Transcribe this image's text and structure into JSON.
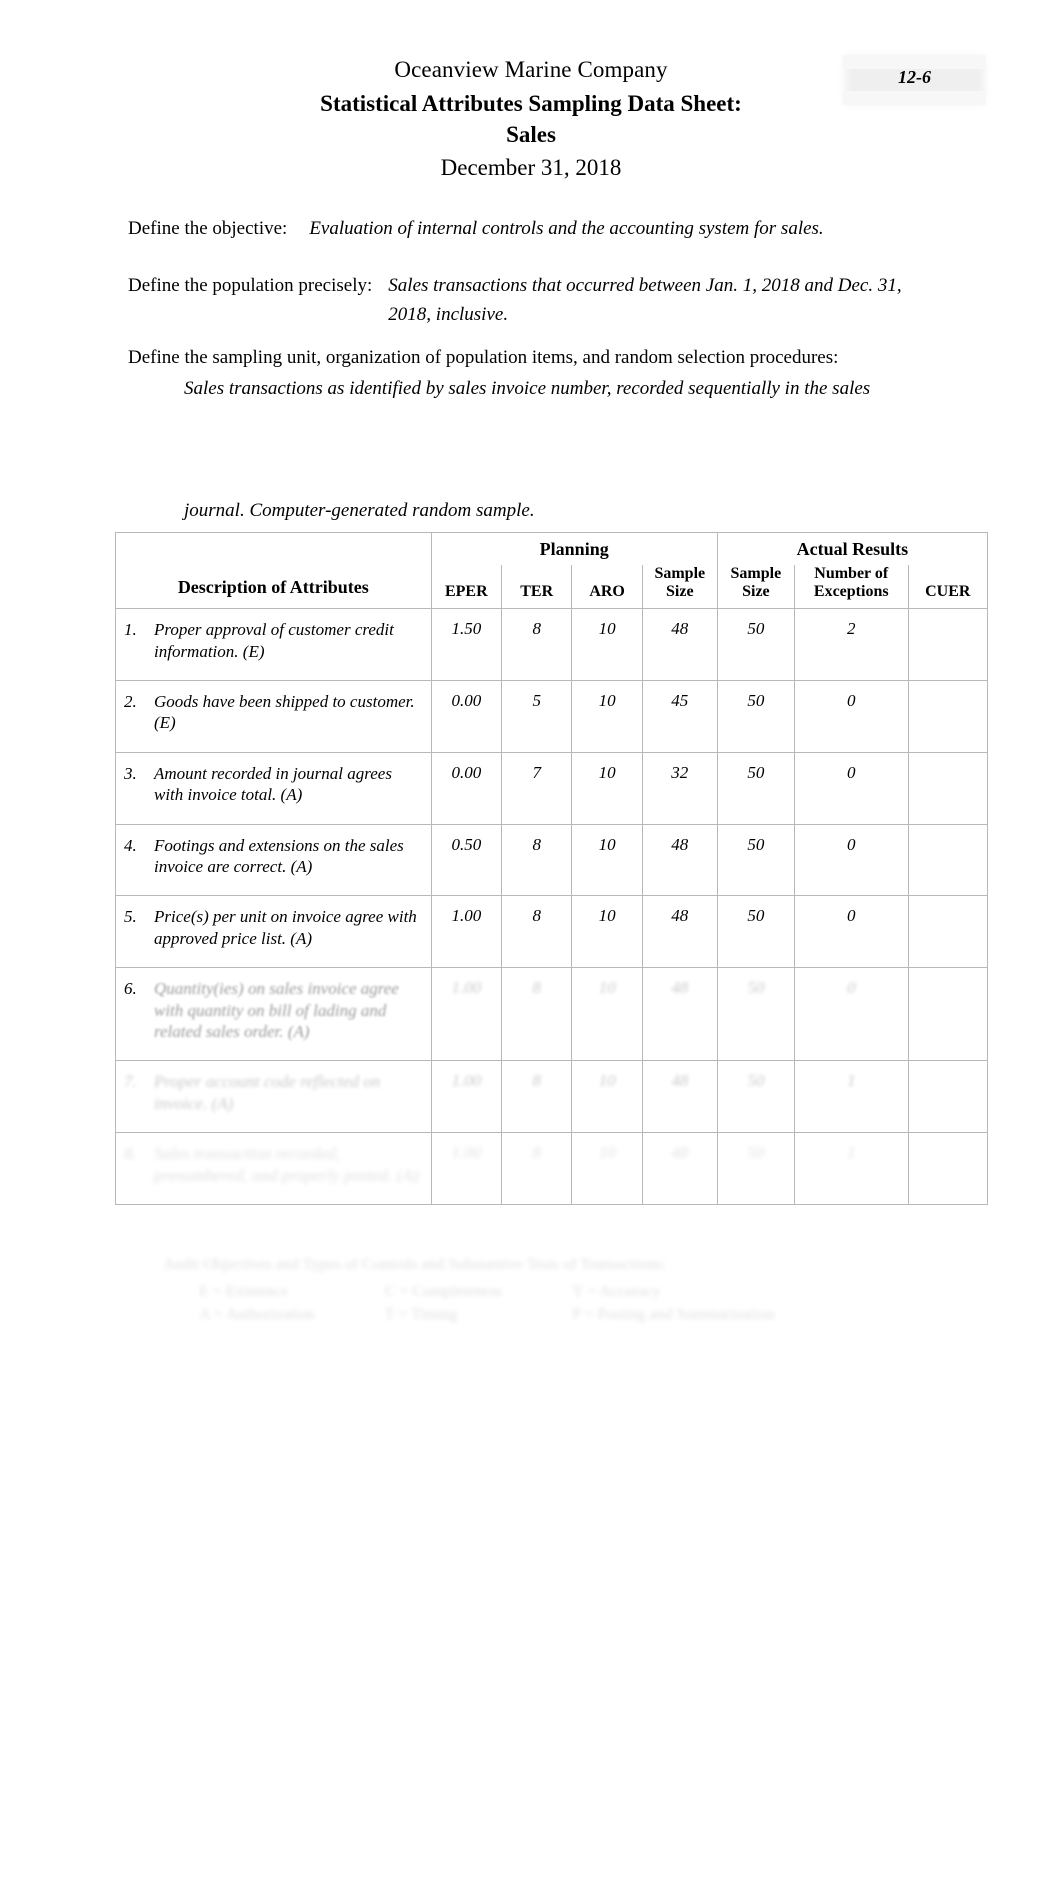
{
  "header": {
    "company": "Oceanview Marine Company",
    "title": "Statistical Attributes Sampling Data Sheet:",
    "subject": "Sales",
    "date": "December 31, 2018"
  },
  "page_ref": {
    "label": "12-6"
  },
  "definitions": {
    "objective_label": "Define the objective:",
    "objective_value": "Evaluation of internal controls and the accounting system for sales.",
    "population_label": "Define the population precisely:",
    "population_value": "Sales transactions that occurred between Jan. 1, 2018 and Dec. 31, 2018, inclusive.",
    "sampling_unit_label": "Define the sampling unit, organization of population items, and random selection procedures:",
    "sampling_unit_value": "Sales transactions as identified by sales invoice number, recorded sequentially in the sales",
    "sampling_unit_continuation": "journal. Computer-generated random sample."
  },
  "table": {
    "group_headers": {
      "description": "Description of Attributes",
      "planning": "Planning",
      "actual_results": "Actual Results"
    },
    "columns": [
      "EPER",
      "TER",
      "ARO",
      "Sample Size",
      "Sample Size",
      "Number of Exceptions",
      "CUER"
    ],
    "column_lines": {
      "eper": "EPER",
      "ter": "TER",
      "aro": "ARO",
      "sample_size_plan_l1": "Sample",
      "sample_size_plan_l2": "Size",
      "sample_size_actual_l1": "Sample",
      "sample_size_actual_l2": "Size",
      "exceptions_l1": "Number of",
      "exceptions_l2": "Exceptions",
      "cuer": "CUER"
    },
    "rows": [
      {
        "num": "1.",
        "description": "Proper approval of customer credit information. (E)",
        "eper": "1.50",
        "ter": "8",
        "aro": "10",
        "sample_size_plan": "48",
        "sample_size_actual": "50",
        "exceptions": "2",
        "cuer": ""
      },
      {
        "num": "2.",
        "description": "Goods have been shipped to customer. (E)",
        "eper": "0.00",
        "ter": "5",
        "aro": "10",
        "sample_size_plan": "45",
        "sample_size_actual": "50",
        "exceptions": "0",
        "cuer": ""
      },
      {
        "num": "3.",
        "description": "Amount recorded in journal agrees with invoice total. (A)",
        "eper": "0.00",
        "ter": "7",
        "aro": "10",
        "sample_size_plan": "32",
        "sample_size_actual": "50",
        "exceptions": "0",
        "cuer": ""
      },
      {
        "num": "4.",
        "description": "Footings and extensions on the sales invoice are correct. (A)",
        "eper": "0.50",
        "ter": "8",
        "aro": "10",
        "sample_size_plan": "48",
        "sample_size_actual": "50",
        "exceptions": "0",
        "cuer": ""
      },
      {
        "num": "5.",
        "description": "Price(s) per unit on invoice agree with approved price list. (A)",
        "eper": "1.00",
        "ter": "8",
        "aro": "10",
        "sample_size_plan": "48",
        "sample_size_actual": "50",
        "exceptions": "0",
        "cuer": ""
      },
      {
        "num": "6.",
        "description": "Quantity(ies) on sales invoice agree with quantity on bill of lading and related sales order. (A)",
        "eper": "1.00",
        "ter": "8",
        "aro": "10",
        "sample_size_plan": "48",
        "sample_size_actual": "50",
        "exceptions": "0",
        "cuer": ""
      },
      {
        "num": "7.",
        "description": "Proper account code reflected on invoice. (A)",
        "eper": "1.00",
        "ter": "8",
        "aro": "10",
        "sample_size_plan": "48",
        "sample_size_actual": "50",
        "exceptions": "1",
        "cuer": ""
      },
      {
        "num": "8.",
        "description": "Sales transaction recorded, prenumbered, and properly posted. (A)",
        "eper": "1.00",
        "ter": "8",
        "aro": "10",
        "sample_size_plan": "48",
        "sample_size_actual": "50",
        "exceptions": "1",
        "cuer": ""
      }
    ]
  },
  "footnote": {
    "title": "Audit Objectives and Types of Controls and Substantive Tests of Transactions:",
    "col1_line1": "E = Existence",
    "col1_line2": "A = Authorization",
    "col2_line1": "C = Completeness",
    "col2_line2": "T = Timing",
    "col3_line1": "Y = Accuracy",
    "col3_line2": "P = Posting and Summarization"
  }
}
